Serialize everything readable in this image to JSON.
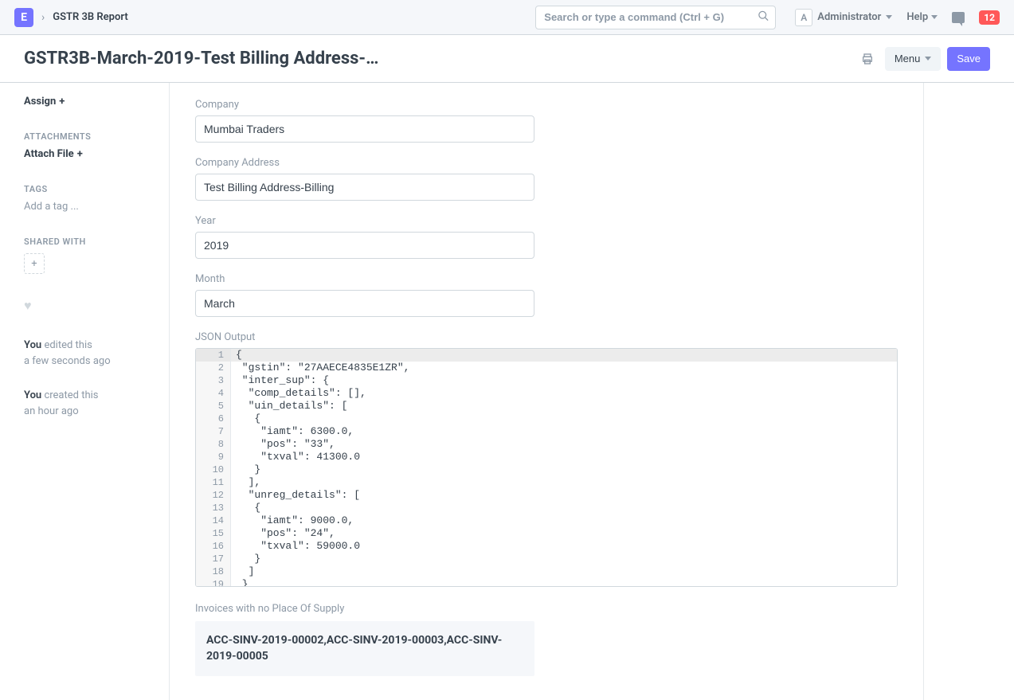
{
  "topbar": {
    "logo_letter": "E",
    "breadcrumb": "GSTR 3B Report",
    "search_placeholder": "Search or type a command (Ctrl + G)",
    "user_avatar_letter": "A",
    "user_name": "Administrator",
    "help_label": "Help",
    "notif_count": "12"
  },
  "page": {
    "title": "GSTR3B-March-2019-Test Billing Address-…",
    "menu_label": "Menu",
    "save_label": "Save"
  },
  "sidebar": {
    "assign_label": "Assign",
    "attachments_header": "ATTACHMENTS",
    "attach_label": "Attach File",
    "tags_header": "TAGS",
    "tags_placeholder": "Add a tag ...",
    "shared_header": "SHARED WITH",
    "timeline": [
      {
        "prefix": "You",
        "action": "edited this",
        "time": "a few seconds ago"
      },
      {
        "prefix": "You",
        "action": "created this",
        "time": "an hour ago"
      }
    ]
  },
  "form": {
    "company_label": "Company",
    "company_value": "Mumbai Traders",
    "address_label": "Company Address",
    "address_value": "Test Billing Address-Billing",
    "year_label": "Year",
    "year_value": "2019",
    "month_label": "Month",
    "month_value": "March",
    "json_label": "JSON Output",
    "json_lines": [
      "{",
      " \"gstin\": \"27AAECE4835E1ZR\",",
      " \"inter_sup\": {",
      "  \"comp_details\": [],",
      "  \"uin_details\": [",
      "   {",
      "    \"iamt\": 6300.0,",
      "    \"pos\": \"33\",",
      "    \"txval\": 41300.0",
      "   }",
      "  ],",
      "  \"unreg_details\": [",
      "   {",
      "    \"iamt\": 9000.0,",
      "    \"pos\": \"24\",",
      "    \"txval\": 59000.0",
      "   }",
      "  ]",
      " }"
    ],
    "missing_label": "Invoices with no Place Of Supply",
    "missing_value": "ACC-SINV-2019-00002,ACC-SINV-2019-00003,ACC-SINV-2019-00005"
  }
}
